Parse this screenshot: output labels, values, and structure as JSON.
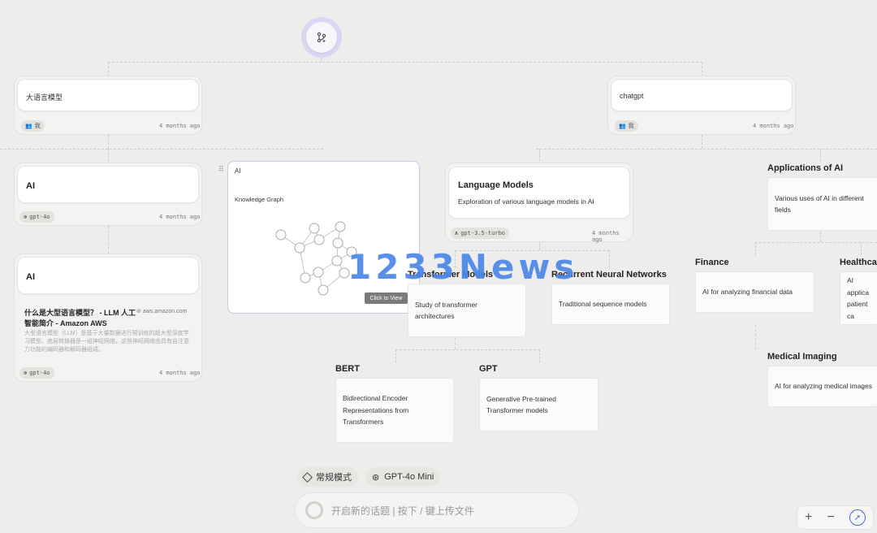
{
  "top_nodes": {
    "left": {
      "title": "大语言模型",
      "owner": "我",
      "time": "4 months ago"
    },
    "right": {
      "title": "chatgpt",
      "owner": "我",
      "time": "4 months ago"
    }
  },
  "ai_card_1": {
    "title": "AI",
    "model": "gpt-4o",
    "time": "4 months ago"
  },
  "ai_card_2": {
    "title": "AI",
    "link_title": "什么是大型语言模型？ - LLM 人工智能简介 - Amazon AWS",
    "link_domain": "aws.amazon.com",
    "link_snippet": "大型语言模型（LLM）是基于大量数据进行预训练的超大型深度学习模型。底层转换器是一组神经网络，这些神经网络由具有自注意力功能的编码器和解码器组成。",
    "model": "gpt-4o",
    "time": "4 months ago"
  },
  "kg_card": {
    "title": "AI",
    "subtitle": "Knowledge Graph",
    "button": "Click to View"
  },
  "lm_card": {
    "title": "Language Models",
    "desc": "Exploration of various language models in AI",
    "model": "gpt-3.5-turbo",
    "time": "4 months ago"
  },
  "mindmap": {
    "transformer": {
      "label": "Transformer Models",
      "desc": "Study of transformer architectures"
    },
    "rnn": {
      "label": "Recurrent Neural Networks",
      "desc": "Traditional sequence models"
    },
    "bert": {
      "label": "BERT",
      "desc": "Bidirectional Encoder Representations from Transformers"
    },
    "gpt": {
      "label": "GPT",
      "desc": "Generative Pre-trained Transformer models"
    },
    "applications": {
      "label": "Applications of AI",
      "desc": "Various uses of AI in different fields"
    },
    "finance": {
      "label": "Finance",
      "desc": "AI for analyzing financial data"
    },
    "healthcare": {
      "label": "Healthca",
      "desc": "AI applica patient ca"
    },
    "imaging": {
      "label": "Medical Imaging",
      "desc": "AI for analyzing medical images"
    }
  },
  "watermark": "1233News",
  "bottom": {
    "mode_label": "常规模式",
    "model_label": "GPT-4o Mini",
    "input_placeholder": "开启新的话题 | 按下 / 键上传文件"
  },
  "zoom": {
    "plus": "+",
    "minus": "−"
  }
}
